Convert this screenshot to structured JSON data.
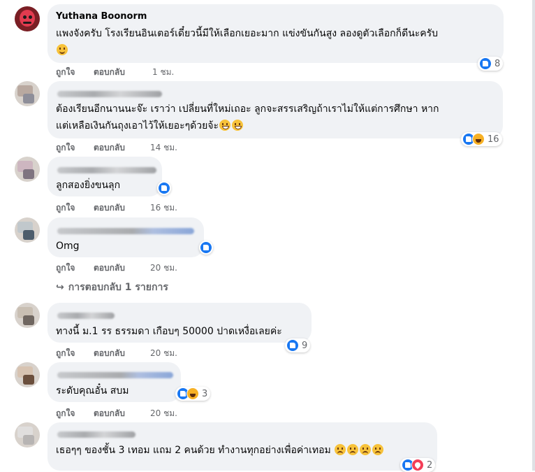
{
  "comments": [
    {
      "author": "Yuthana Boonorm",
      "text": [
        "แพงจังครับ โรงเรียนอินเตอร์เดี๋ยวนี้มีให้เลือกเยอะมาก แข่งขันกันสูง ลองดูตัวเลือกก็ดีนะครับ"
      ],
      "emoji": [
        "slightly-smiling-face"
      ],
      "like_label": "ถูกใจ",
      "reply_label": "ตอบกลับ",
      "time": "1 ชม.",
      "reactions": [
        "like"
      ],
      "reaction_count": "8"
    },
    {
      "author": "",
      "text": [
        "ต้องเรียนอีกนานนะจ๊ะ เราว่า เปลี่ยนที่ใหม่เถอะ ลูกจะสรรเสริญถ้าเราไม่ให้แต่การศึกษา หาก",
        "แต่เหลือเงินกันถุงเอาไว้ให้เยอะๆด้วยจ้ะ"
      ],
      "emoji": [
        "grinning-face",
        "grinning-face"
      ],
      "like_label": "ถูกใจ",
      "reply_label": "ตอบกลับ",
      "time": "14 ชม.",
      "reactions": [
        "like",
        "haha"
      ],
      "reaction_count": "16"
    },
    {
      "author": "",
      "text": [
        "ลูกสองยิ่งขนลุก"
      ],
      "like_label": "ถูกใจ",
      "reply_label": "ตอบกลับ",
      "time": "16 ชม.",
      "reactions": [
        "like"
      ],
      "reaction_count": ""
    },
    {
      "author": "",
      "text": [
        "Omg"
      ],
      "like_label": "ถูกใจ",
      "reply_label": "ตอบกลับ",
      "time": "20 ชม.",
      "reactions": [
        "like"
      ],
      "reaction_count": "",
      "replies_link": "การตอบกลับ 1 รายการ"
    },
    {
      "author": "",
      "text": [
        "ทางนี้ ม.1 รร ธรรมดา เกือบๆ 50000 ปาดเหงื่อเลยค่ะ"
      ],
      "like_label": "ถูกใจ",
      "reply_label": "ตอบกลับ",
      "time": "20 ชม.",
      "reactions": [
        "like"
      ],
      "reaction_count": "9"
    },
    {
      "author": "",
      "text": [
        "ระดับคุณอั๋น สบม"
      ],
      "like_label": "ถูกใจ",
      "reply_label": "ตอบกลับ",
      "time": "20 ชม.",
      "reactions": [
        "like",
        "haha"
      ],
      "reaction_count": "3"
    },
    {
      "author": "",
      "text": [
        "เธอๆๆ ของชั้น 3 เทอม แถม 2 คนด้วย ทำงานทุกอย่างเพื่อค่าเทอม"
      ],
      "emoji": [
        "weary-face",
        "weary-face",
        "weary-face",
        "weary-face"
      ],
      "reactions": [
        "like",
        "heart"
      ],
      "reaction_count": "2"
    }
  ]
}
